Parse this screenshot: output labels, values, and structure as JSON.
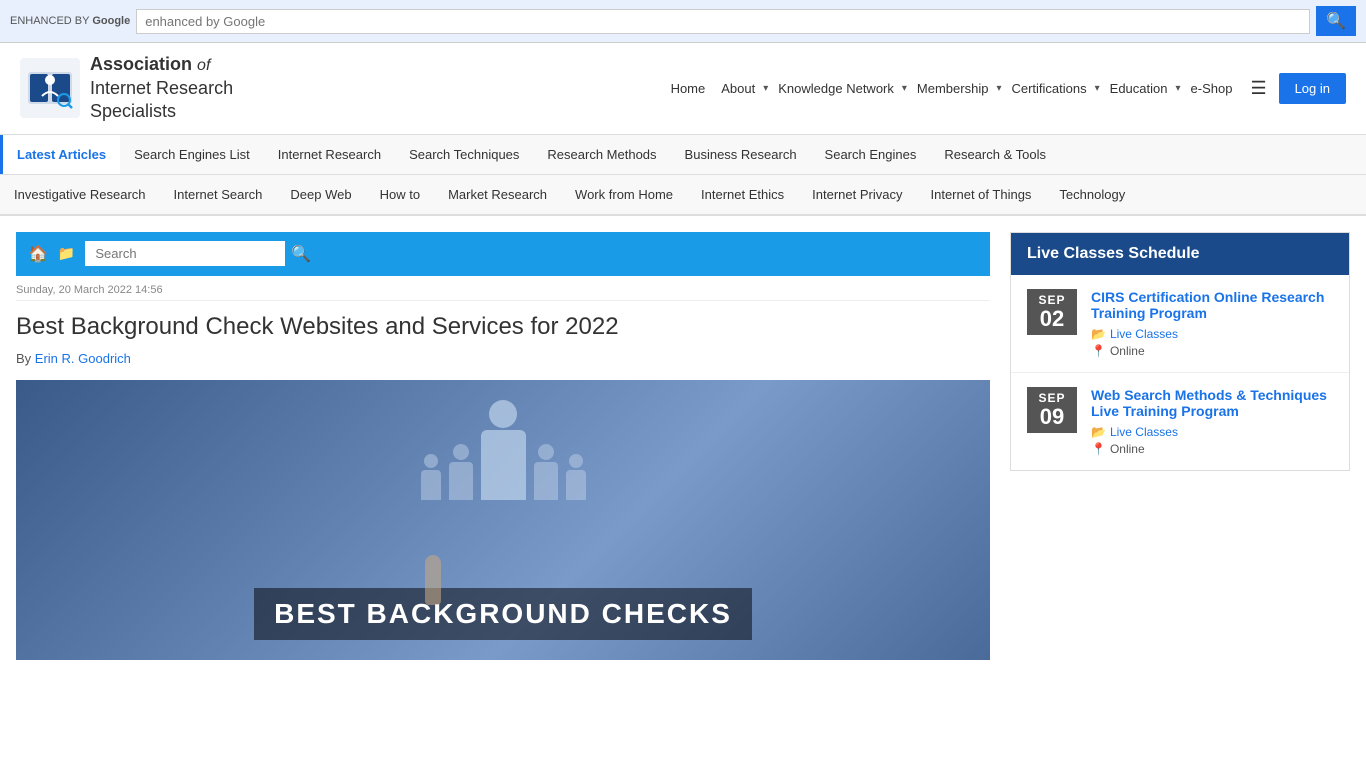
{
  "google_bar": {
    "placeholder": "enhanced by Google",
    "enhanced_by": "ENHANCED BY",
    "google": "Google",
    "search_icon": "🔍"
  },
  "header": {
    "logo": {
      "line1": "Association",
      "of_italic": "of",
      "line2": "Internet Research",
      "line3": "Specialists"
    },
    "nav": {
      "home": "Home",
      "about": "About",
      "knowledge_network": "Knowledge Network",
      "membership": "Membership",
      "certifications": "Certifications",
      "education": "Education",
      "eshop": "e-Shop",
      "login": "Log in"
    }
  },
  "cat_nav_1": {
    "items": [
      {
        "label": "Latest Articles",
        "active": true
      },
      {
        "label": "Search Engines List",
        "active": false
      },
      {
        "label": "Internet Research",
        "active": false
      },
      {
        "label": "Search Techniques",
        "active": false
      },
      {
        "label": "Research Methods",
        "active": false
      },
      {
        "label": "Business Research",
        "active": false
      },
      {
        "label": "Search Engines",
        "active": false
      },
      {
        "label": "Research & Tools",
        "active": false
      }
    ]
  },
  "cat_nav_2": {
    "items": [
      {
        "label": "Investigative Research"
      },
      {
        "label": "Internet Search"
      },
      {
        "label": "Deep Web"
      },
      {
        "label": "How to"
      },
      {
        "label": "Market Research"
      },
      {
        "label": "Work from Home"
      },
      {
        "label": "Internet Ethics"
      },
      {
        "label": "Internet Privacy"
      },
      {
        "label": "Internet of Things"
      },
      {
        "label": "Technology"
      }
    ]
  },
  "breadcrumb": {
    "home_icon": "🏠",
    "folder_icon": "📁",
    "search_placeholder": "Search",
    "search_icon": "🔍"
  },
  "article": {
    "date": "Sunday, 20 March 2022 14:56",
    "title": "Best Background Check Websites and Services for 2022",
    "author_label": "By",
    "author_name": "Erin R. Goodrich",
    "image_text": "BEST BACKGROUND CHECKS"
  },
  "sidebar": {
    "schedule_title": "Live Classes Schedule",
    "events": [
      {
        "month": "SEP",
        "day": "02",
        "title": "CIRS Certification Online Research Training Program",
        "category": "Live Classes",
        "location": "Online"
      },
      {
        "month": "SEP",
        "day": "09",
        "title": "Web Search Methods & Techniques Live Training Program",
        "category": "Live Classes",
        "location": "Online"
      }
    ]
  }
}
